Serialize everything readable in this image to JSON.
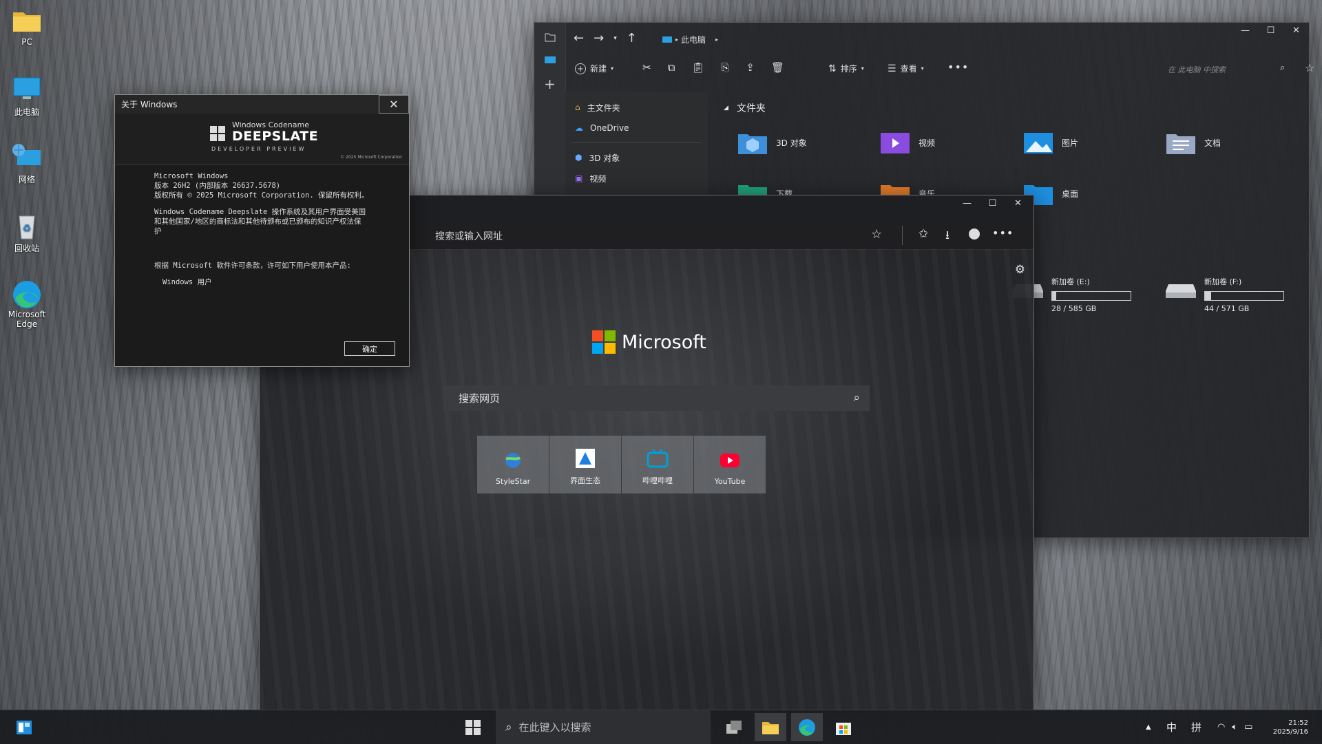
{
  "desktop": {
    "icons": [
      {
        "label": "PC"
      },
      {
        "label": "此电脑"
      },
      {
        "label": "网络"
      },
      {
        "label": "回收站"
      },
      {
        "label": "Microsoft Edge"
      }
    ]
  },
  "explorer": {
    "breadcrumb": "此电脑",
    "toolbar": {
      "new": "新建",
      "sort": "排序",
      "view": "查看"
    },
    "search_placeholder": "在 此电脑 中搜索",
    "nav": [
      {
        "label": "主文件夹",
        "icon": "home-icon"
      },
      {
        "label": "OneDrive",
        "icon": "cloud-icon"
      },
      {
        "label": "3D 对象",
        "icon": "cube-icon"
      },
      {
        "label": "视频",
        "icon": "video-icon"
      }
    ],
    "section_title": "文件夹",
    "folders": [
      {
        "label": "3D 对象"
      },
      {
        "label": "视频"
      },
      {
        "label": "图片"
      },
      {
        "label": "文档"
      },
      {
        "label": "下载"
      },
      {
        "label": "音乐"
      },
      {
        "label": "桌面"
      }
    ],
    "drives": [
      {
        "label": "新加卷 (E:)",
        "usage": "28 / 585 GB",
        "fill": 0.05
      },
      {
        "label": "新加卷 (F:)",
        "usage": "44 / 571 GB",
        "fill": 0.08
      }
    ]
  },
  "about": {
    "title": "关于 Windows",
    "banner_line1": "Windows Codename",
    "banner_line2": "DEEPSLATE",
    "banner_line3": "DEVELOPER PREVIEW",
    "copyright_small": "© 2025 Microsoft Corporation",
    "line1": "Microsoft Windows",
    "line2": "版本 26H2 (内部版本 26637.5678)",
    "line3": "版权所有 © 2025 Microsoft Corporation. 保留所有权利。",
    "para1": "Windows Codename Deepslate 操作系统及其用户界面受美国和其他国家/地区的商标法和其他待颁布或已颁布的知识产权法保护",
    "license": "根据 Microsoft 软件许可条款，许可如下用户使用本产品:",
    "user": "Windows 用户",
    "ok": "确定"
  },
  "edge": {
    "address_placeholder": "搜索或输入网址",
    "brand": "Microsoft",
    "search_placeholder": "搜索网页",
    "tiles": [
      {
        "label": "StyleStar"
      },
      {
        "label": "界面生态"
      },
      {
        "label": "哔哩哔哩"
      },
      {
        "label": "YouTube"
      }
    ]
  },
  "taskbar": {
    "search_placeholder": "在此键入以搜索",
    "ime1": "中",
    "ime2": "拼",
    "time": "21:52",
    "date": "2025/9/16"
  },
  "colors": {
    "accent": "#0a84ff",
    "youtube": "#ff0033",
    "bilibili": "#00a1d6"
  }
}
